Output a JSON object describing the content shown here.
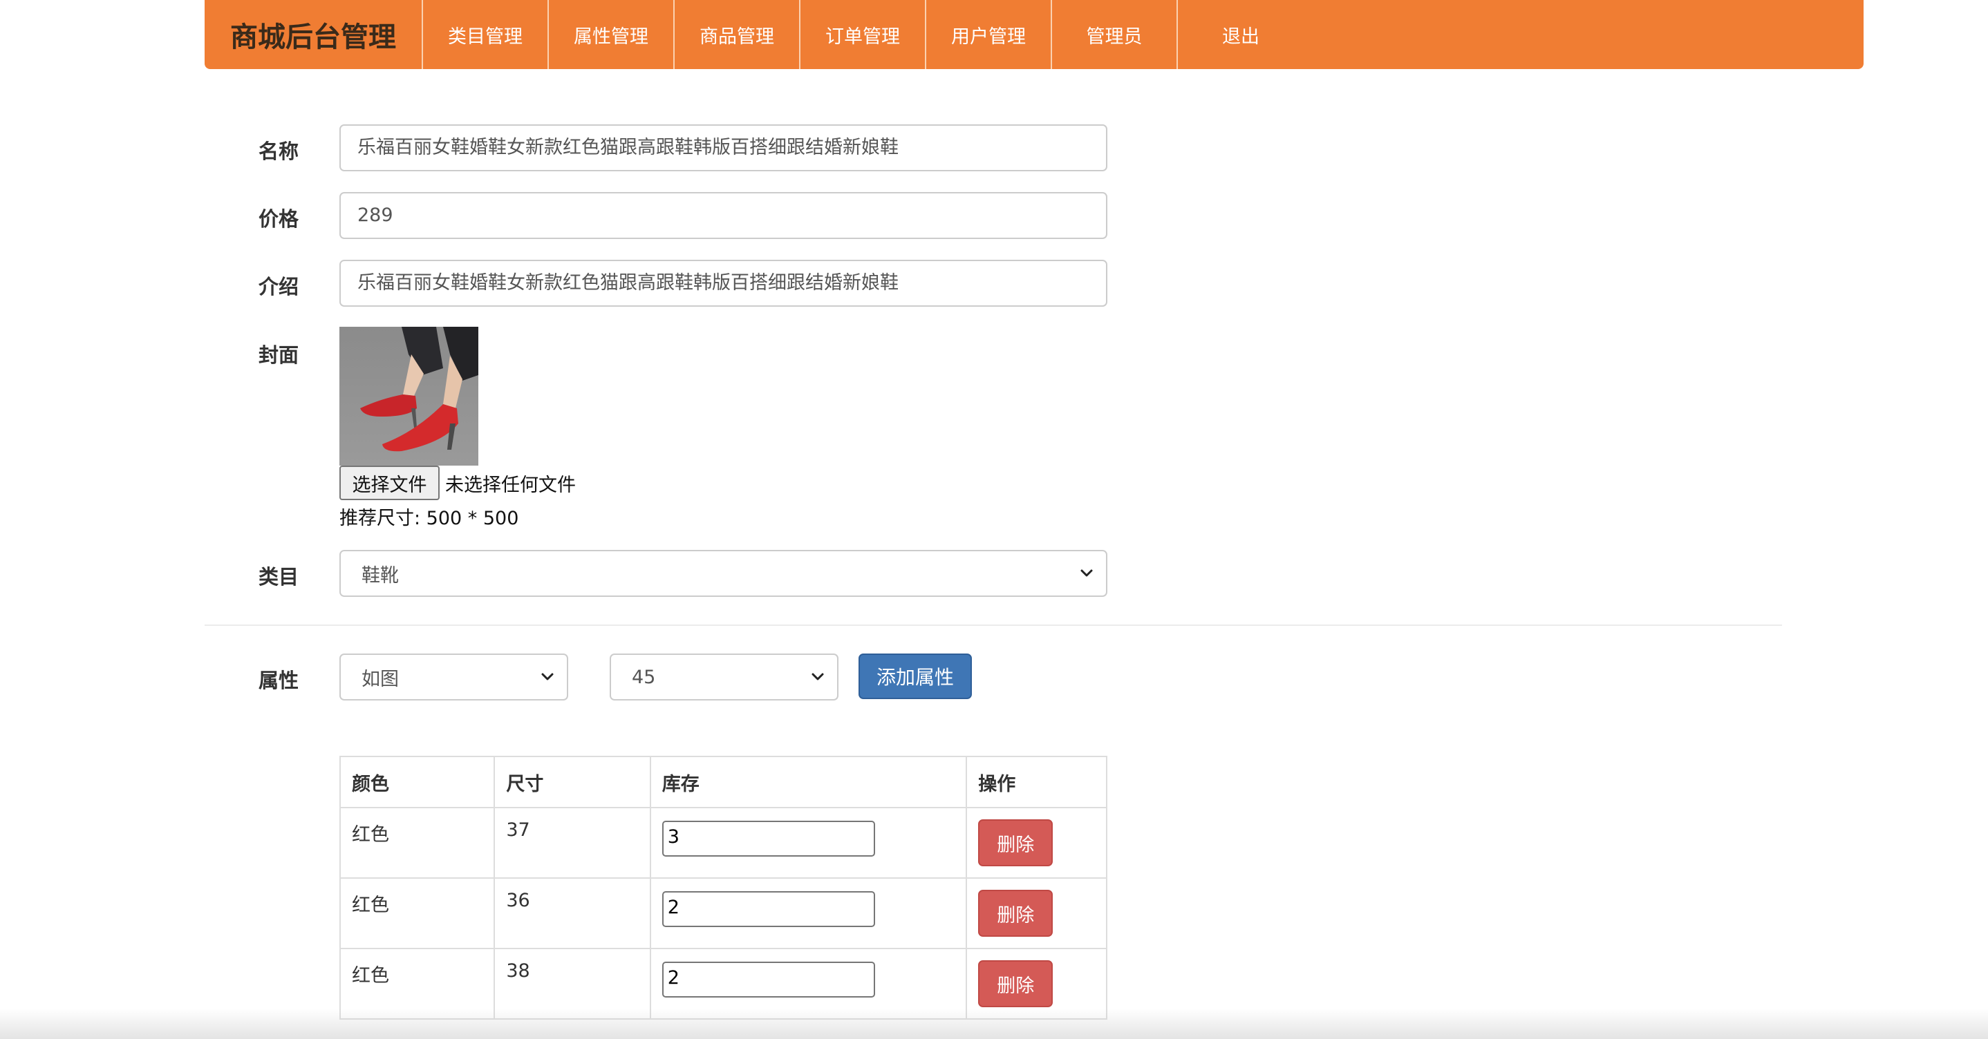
{
  "navbar": {
    "brand": "商城后台管理",
    "items": [
      "类目管理",
      "属性管理",
      "商品管理",
      "订单管理",
      "用户管理",
      "管理员",
      "退出"
    ]
  },
  "form": {
    "name_label": "名称",
    "name_value": "乐福百丽女鞋婚鞋女新款红色猫跟高跟鞋韩版百搭细跟结婚新娘鞋",
    "price_label": "价格",
    "price_value": "289",
    "intro_label": "介绍",
    "intro_value": "乐福百丽女鞋婚鞋女新款红色猫跟高跟鞋韩版百搭细跟结婚新娘鞋",
    "cover_label": "封面",
    "file_button": "选择文件",
    "file_status": "未选择任何文件",
    "size_hint": "推荐尺寸: 500 * 500",
    "category_label": "类目",
    "category_value": "鞋靴"
  },
  "attributes": {
    "label": "属性",
    "color_select": "如图",
    "size_select": "45",
    "add_button": "添加属性"
  },
  "table": {
    "headers": [
      "颜色",
      "尺寸",
      "库存",
      "操作"
    ],
    "rows": [
      {
        "color": "红色",
        "size": "37",
        "stock": "3",
        "action": "删除"
      },
      {
        "color": "红色",
        "size": "36",
        "stock": "2",
        "action": "删除"
      },
      {
        "color": "红色",
        "size": "38",
        "stock": "2",
        "action": "删除"
      }
    ]
  },
  "icons": {
    "select_arrow": "chevron-down-icon",
    "cover_image": "red-high-heel-shoe-photo"
  },
  "colors": {
    "navbar": "#f07d33",
    "primary_button": "#3f76b5",
    "danger_button": "#d45a56"
  }
}
